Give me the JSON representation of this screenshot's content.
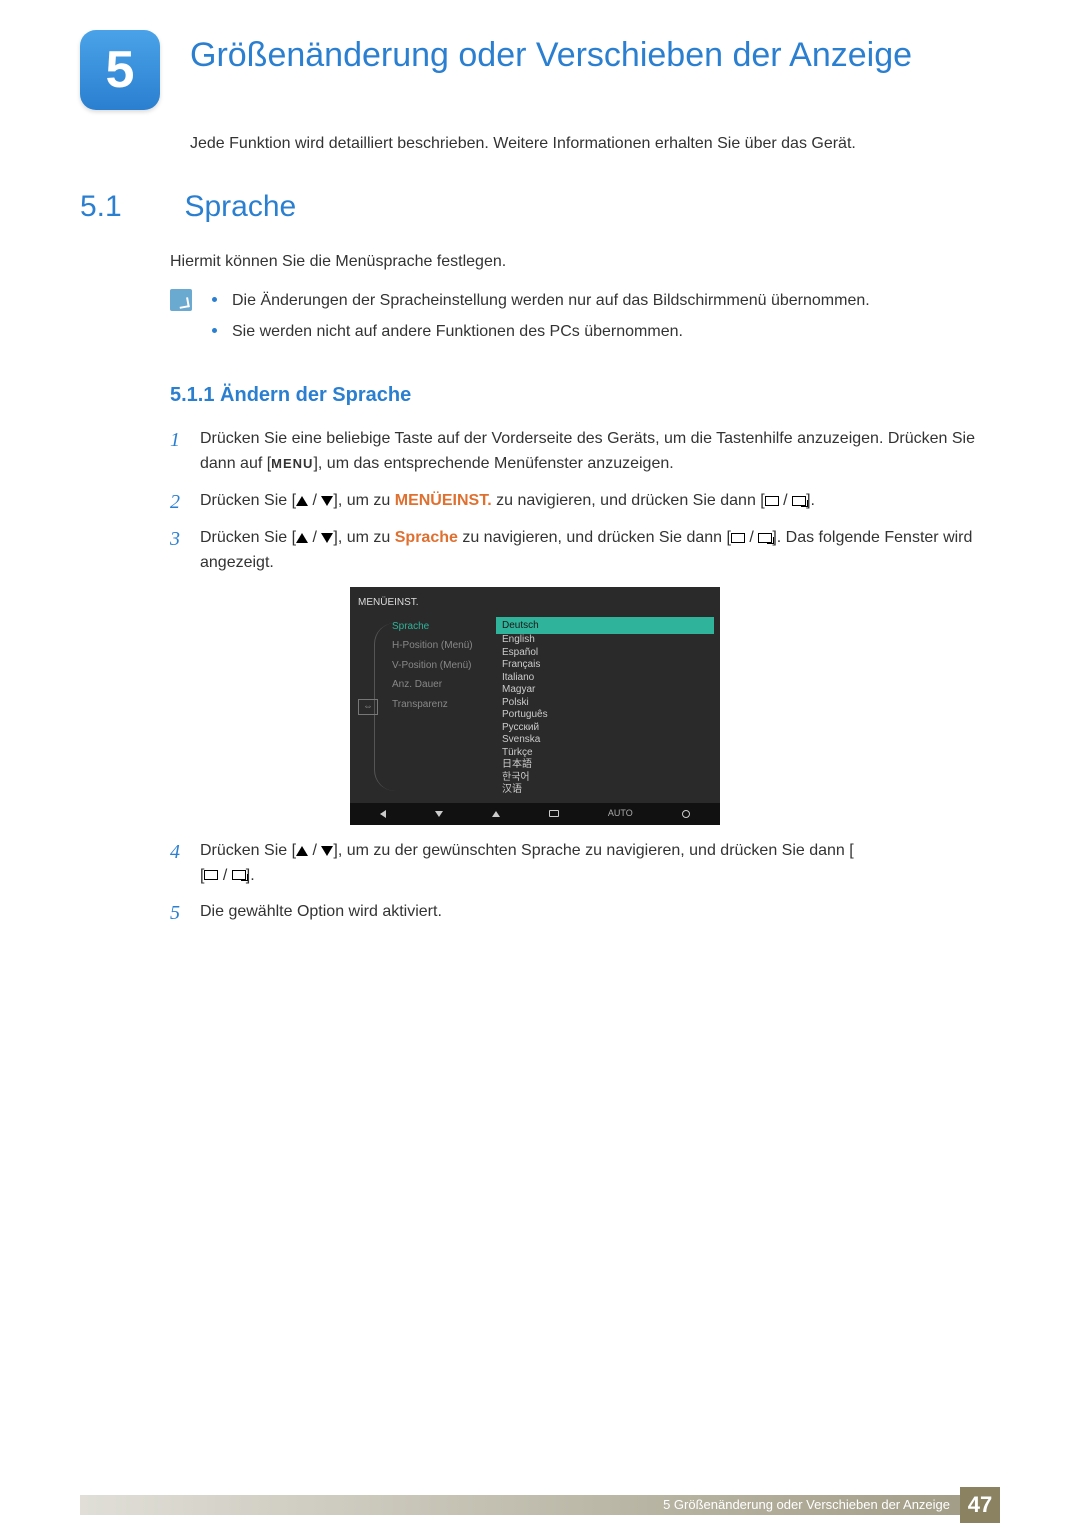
{
  "chapter": {
    "number": "5",
    "title": "Größenänderung oder Verschieben der Anzeige"
  },
  "intro": "Jede Funktion wird detailliert beschrieben. Weitere Informationen erhalten Sie über das Gerät.",
  "section": {
    "number": "5.1",
    "title": "Sprache"
  },
  "section_body": "Hiermit können Sie die Menüsprache festlegen.",
  "notes": [
    "Die Änderungen der Spracheinstellung werden nur auf das Bildschirmmenü übernommen.",
    "Sie werden nicht auf andere Funktionen des PCs übernommen."
  ],
  "subsection": {
    "number": "5.1.1",
    "title": "Ändern der Sprache"
  },
  "steps": {
    "s1a": "Drücken Sie eine beliebige Taste auf der Vorderseite des Geräts, um die Tastenhilfe anzuzeigen. Drücken Sie dann auf [",
    "s1_menu": "MENU",
    "s1b": "], um das entsprechende Menüfenster anzuzeigen.",
    "s2a": "Drücken Sie [",
    "s2b": "], um zu ",
    "s2_target": "MENÜEINST.",
    "s2c": " zu navigieren, und drücken Sie dann [",
    "s2d": "].",
    "s3a": "Drücken Sie [",
    "s3b": "], um zu ",
    "s3_target": "Sprache",
    "s3c": " zu navigieren, und drücken Sie dann [",
    "s3d": "]. Das folgende Fenster wird angezeigt.",
    "s4a": "Drücken Sie [",
    "s4b": "], um zu der gewünschten Sprache zu navigieren, und drücken Sie dann [",
    "s4c": "].",
    "s5": "Die gewählte Option wird aktiviert."
  },
  "osd": {
    "title": "MENÜEINST.",
    "left_items": [
      "Sprache",
      "H-Position (Menü)",
      "V-Position (Menü)",
      "Anz. Dauer",
      "Transparenz"
    ],
    "languages": [
      "Deutsch",
      "English",
      "Español",
      "Français",
      "Italiano",
      "Magyar",
      "Polski",
      "Português",
      "Русский",
      "Svenska",
      "Türkçe",
      "日本語",
      "한국어",
      "汉语"
    ],
    "bottom_auto": "AUTO"
  },
  "footer": {
    "text": "5 Größenänderung oder Verschieben der Anzeige",
    "page": "47"
  }
}
